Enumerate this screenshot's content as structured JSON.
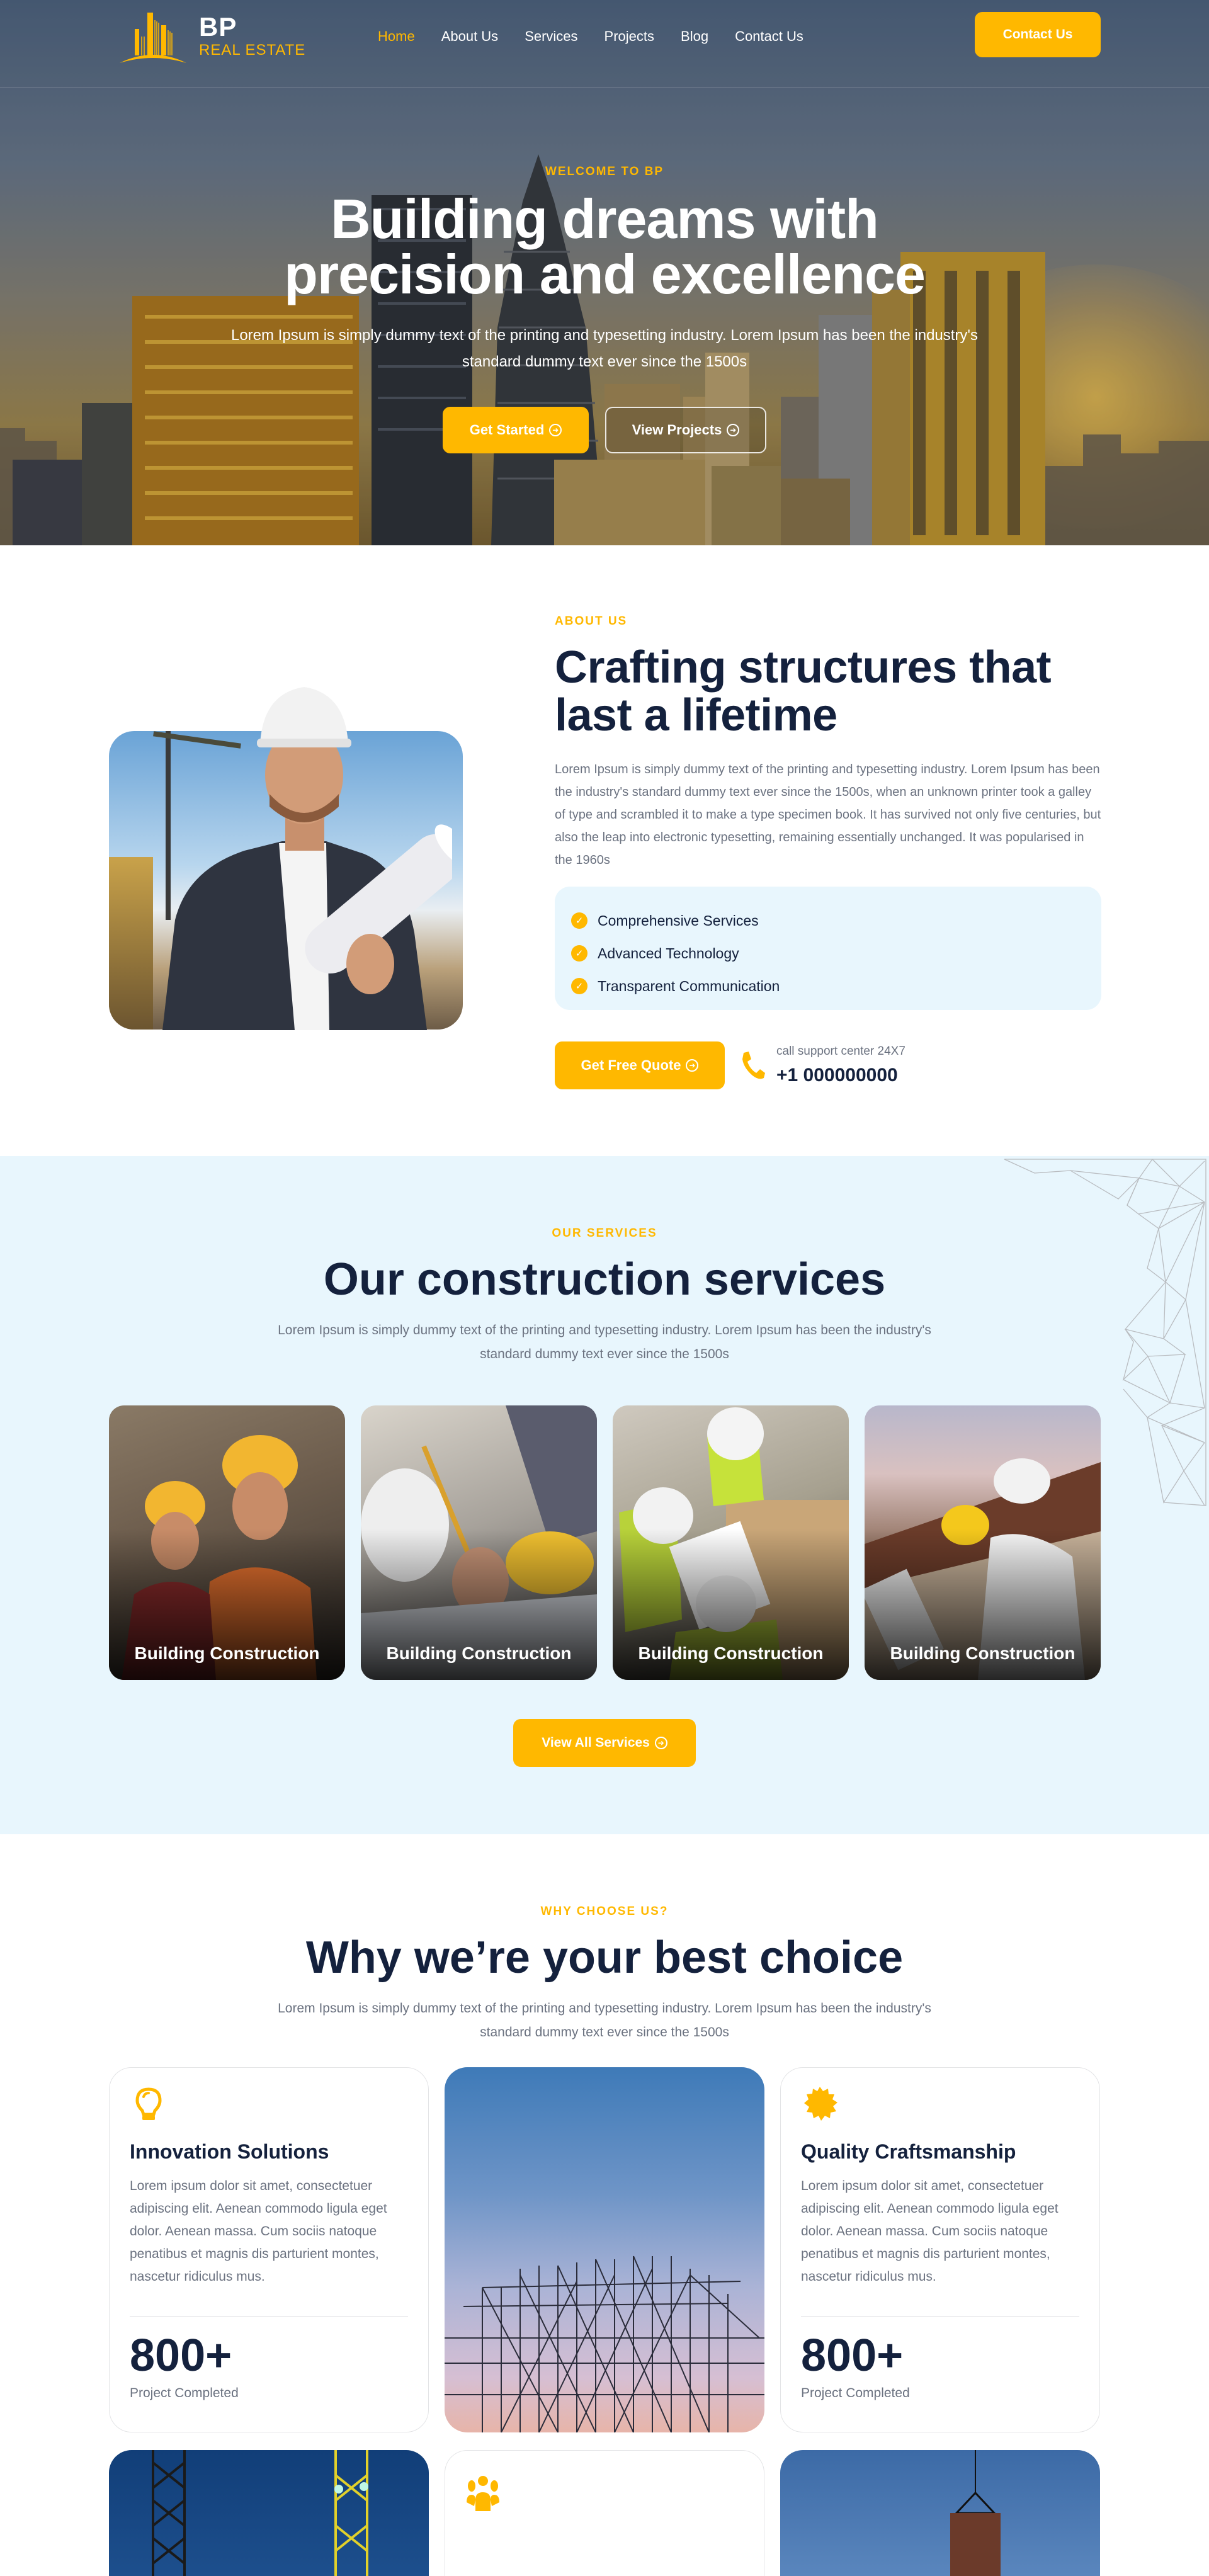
{
  "brand": {
    "name": "BP",
    "subtitle": "REAL ESTATE",
    "accent_color": "#ffb800",
    "heading_color": "#14213d",
    "light_bg_color": "#e8f6fd"
  },
  "nav": {
    "links": [
      {
        "label": "Home",
        "active": true
      },
      {
        "label": "About Us",
        "active": false
      },
      {
        "label": "Services",
        "active": false
      },
      {
        "label": "Projects",
        "active": false
      },
      {
        "label": "Blog",
        "active": false
      },
      {
        "label": "Contact Us",
        "active": false
      }
    ],
    "cta_label": "Contact Us"
  },
  "hero": {
    "eyebrow": "WELCOME TO BP",
    "title_line1": "Building dreams with",
    "title_line2": "precision and excellence",
    "subtitle": "Lorem Ipsum is simply dummy text of the printing and typesetting industry. Lorem Ipsum has been the industry's standard dummy text ever since the 1500s",
    "primary_button": "Get Started",
    "secondary_button": "View Projects",
    "button_icon": "arrow-right-circle-icon"
  },
  "about": {
    "eyebrow": "ABOUT US",
    "title": "Crafting structures that last a lifetime",
    "paragraph": "Lorem Ipsum is simply dummy text of the printing and typesetting industry. Lorem Ipsum has been the industry's standard dummy text ever since the 1500s, when an unknown printer took a galley of type and scrambled it to make a type specimen book. It has survived not only five centuries, but also the leap into electronic typesetting, remaining essentially unchanged. It was popularised in the 1960s",
    "checklist": [
      "Comprehensive Services",
      "Advanced Technology",
      "Transparent Communication"
    ],
    "cta_button": "Get Free Quote",
    "support_label": "call support center 24X7",
    "phone": "+1 000000000"
  },
  "services": {
    "eyebrow": "OUR SERVICES",
    "title": "Our construction services",
    "paragraph": "Lorem Ipsum is simply dummy text of the printing and typesetting industry. Lorem Ipsum has been the industry's standard dummy text ever since the 1500s",
    "cards": [
      {
        "title": "Building Construction"
      },
      {
        "title": "Building Construction"
      },
      {
        "title": "Building Construction"
      },
      {
        "title": "Building Construction"
      }
    ],
    "view_all_button": "View All Services"
  },
  "why": {
    "eyebrow": "WHY CHOOSE US?",
    "title": "Why we’re your best choice",
    "paragraph": "Lorem Ipsum is simply dummy text of the printing and typesetting industry. Lorem Ipsum has been the industry's standard dummy text ever since the 1500s",
    "cards": [
      {
        "icon": "lightbulb-icon",
        "title": "Innovation Solutions",
        "text": "Lorem ipsum dolor sit amet, consectetuer adipiscing elit. Aenean commodo ligula eget dolor. Aenean massa. Cum sociis natoque penatibus et magnis dis parturient montes, nascetur ridiculus mus.",
        "stat": "800+",
        "stat_label": "Project Completed"
      },
      {
        "icon": "badge-icon",
        "title": "Quality Craftsmanship",
        "text": "Lorem ipsum dolor sit amet, consectetuer adipiscing elit. Aenean commodo ligula eget dolor. Aenean massa. Cum sociis natoque penatibus et magnis dis parturient montes, nascetur ridiculus mus.",
        "stat": "800+",
        "stat_label": "Project Completed"
      }
    ],
    "row2_icon": "users-icon"
  }
}
